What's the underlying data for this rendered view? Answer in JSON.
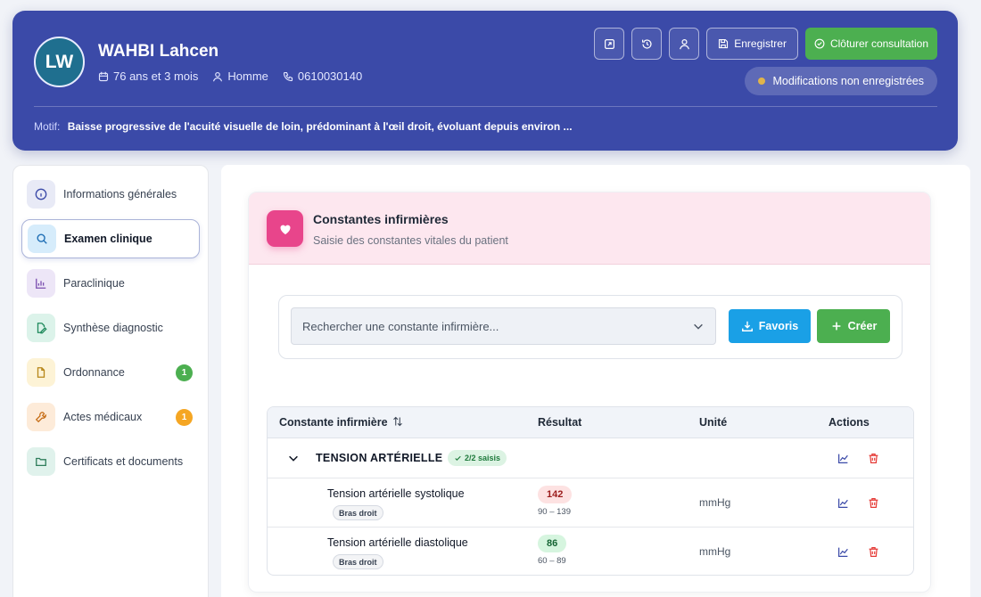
{
  "patient": {
    "initials": "LW",
    "name": "WAHBI Lahcen",
    "age": "76 ans et 3 mois",
    "sex": "Homme",
    "phone": "0610030140"
  },
  "header": {
    "save_label": "Enregistrer",
    "close_label": "Clôturer consultation",
    "unsaved_label": "Modifications non enregistrées",
    "motif_label": "Motif:",
    "motif_text": "Baisse progressive de l'acuité visuelle de loin, prédominant à l'œil droit, évoluant depuis environ ..."
  },
  "sidebar": {
    "items": [
      {
        "label": "Informations générales"
      },
      {
        "label": "Examen clinique"
      },
      {
        "label": "Paraclinique"
      },
      {
        "label": "Synthèse diagnostic"
      },
      {
        "label": "Ordonnance",
        "badge": "1"
      },
      {
        "label": "Actes médicaux",
        "badge": "1"
      },
      {
        "label": "Certificats et documents"
      }
    ]
  },
  "card": {
    "title": "Constantes infirmières",
    "subtitle": "Saisie des constantes vitales du patient"
  },
  "search": {
    "placeholder": "Rechercher une constante infirmière...",
    "favorites_label": "Favoris",
    "create_label": "Créer"
  },
  "table": {
    "columns": [
      "Constante infirmière",
      "Résultat",
      "Unité",
      "Actions"
    ],
    "group": {
      "title": "TENSION ARTÉRIELLE",
      "badge": "2/2 saisis"
    },
    "rows": [
      {
        "label": "Tension artérielle systolique",
        "tag": "Bras droit",
        "value": "142",
        "range": "90 – 139",
        "unit": "mmHg"
      },
      {
        "label": "Tension artérielle diastolique",
        "tag": "Bras droit",
        "value": "86",
        "range": "60 – 89",
        "unit": "mmHg"
      }
    ]
  },
  "colors": {
    "header_bg": "#3b4aa8",
    "green": "#4caf50",
    "blue": "#1aa0e6",
    "pink": "#e8458b",
    "warning": "#f5a623"
  }
}
